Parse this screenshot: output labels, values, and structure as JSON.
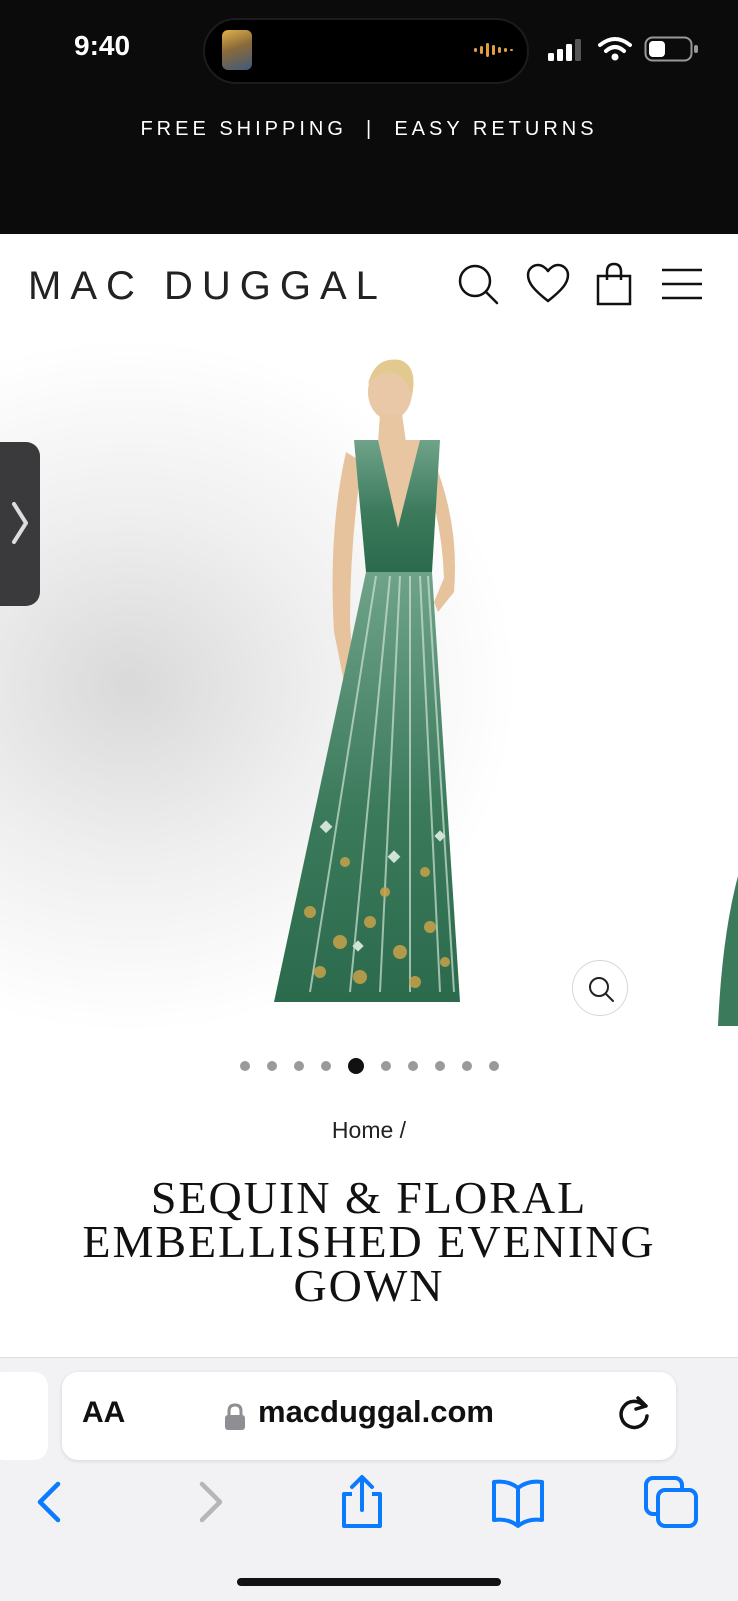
{
  "status_bar": {
    "time": "9:40"
  },
  "promo_banner": {
    "text": "FREE SHIPPING  |  EASY RETURNS"
  },
  "header": {
    "logo": "MAC DUGGAL",
    "icons": [
      "search-icon",
      "heart-icon",
      "shopping-bag-icon",
      "menu-icon"
    ]
  },
  "gallery": {
    "slide_count": 10,
    "active_slide": 5,
    "dress_color": "#2f6b4f"
  },
  "breadcrumb": {
    "home": "Home",
    "separator": " /"
  },
  "product": {
    "title": "SEQUIN & FLORAL EMBELLISHED EVENING GOWN"
  },
  "browser": {
    "aa_label": "AA",
    "url": "macduggal.com",
    "toolbar": [
      "back-icon",
      "forward-icon",
      "share-icon",
      "bookmarks-icon",
      "tabs-icon"
    ],
    "accent": "#0a7aff"
  }
}
